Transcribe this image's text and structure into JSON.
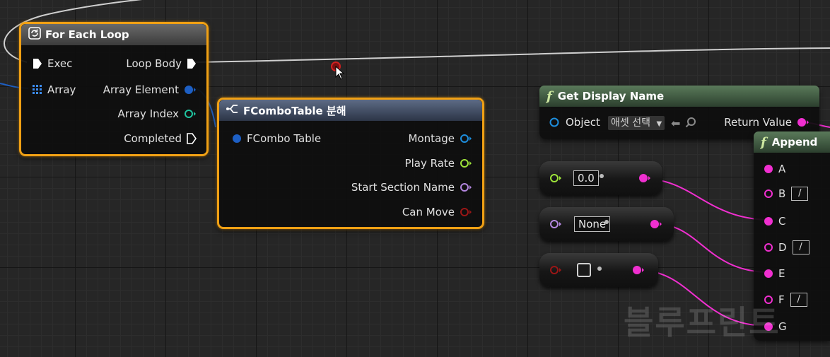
{
  "for_each": {
    "title": "For Each Loop",
    "pins": {
      "exec": "Exec",
      "array": "Array",
      "loop_body": "Loop Body",
      "array_element": "Array Element",
      "array_index": "Array Index",
      "completed": "Completed"
    }
  },
  "break_node": {
    "title": "FComboTable 분해",
    "pins": {
      "input": "FCombo Table",
      "montage": "Montage",
      "play_rate": "Play Rate",
      "start_section": "Start Section Name",
      "can_move": "Can Move"
    }
  },
  "get_display_name": {
    "title": "Get Display Name",
    "object_label": "Object",
    "object_dropdown": "애셋 선택",
    "return_label": "Return Value"
  },
  "append": {
    "title": "Append",
    "pins": [
      "A",
      "B",
      "C",
      "D",
      "E",
      "F",
      "G"
    ],
    "slash": "/"
  },
  "float_to_string": {
    "value": "0.0"
  },
  "name_to_string": {
    "value": "None"
  },
  "watermark": "블루프린트",
  "colors": {
    "selection": "#f0a014",
    "exec": "#ffffff",
    "object": "#1e8fdf",
    "struct": "#1d5fc4",
    "integer": "#1fc4a0",
    "float": "#9ee43a",
    "name": "#b487e0",
    "boolean": "#9a1616",
    "string": "#f02fd0",
    "wire": "#d0d0d0"
  }
}
